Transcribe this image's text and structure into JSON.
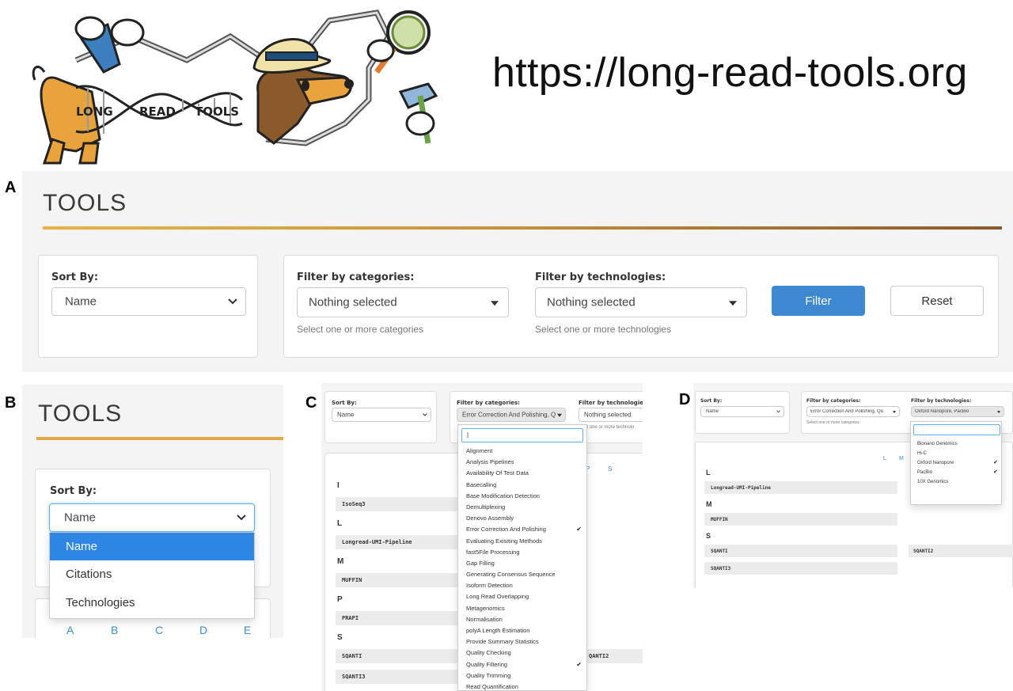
{
  "header": {
    "logo_text": "LONG READ TOOLS",
    "url": "https://long-read-tools.org"
  },
  "panel_labels": {
    "a": "A",
    "b": "B",
    "c": "C",
    "d": "D"
  },
  "panel_a": {
    "title": "TOOLS",
    "sort_label": "Sort By:",
    "sort_value": "Name",
    "categories_label": "Filter by categories:",
    "categories_value": "Nothing selected",
    "categories_hint": "Select one or more categories",
    "technologies_label": "Filter by technologies:",
    "technologies_value": "Nothing selected",
    "technologies_hint": "Select one or more technologies",
    "filter_button": "Filter",
    "reset_button": "Reset",
    "accent_color": "#3d88d1"
  },
  "panel_b": {
    "title": "TOOLS",
    "sort_label": "Sort By:",
    "sort_value": "Name",
    "options": [
      "Name",
      "Citations",
      "Technologies"
    ],
    "selected_option": "Name",
    "alphabet": [
      "A",
      "B",
      "C",
      "D",
      "E"
    ]
  },
  "panel_c": {
    "sort_label": "Sort By:",
    "sort_value": "Name",
    "categories_label": "Filter by categories:",
    "categories_value": "Error Correction And Polishing, Qu",
    "technologies_label": "Filter by technologies:",
    "technologies_value": "Nothing selected",
    "technologies_hint": "ect one or more technolo",
    "search_value": "|",
    "category_options": [
      {
        "label": "Alignment",
        "checked": false
      },
      {
        "label": "Analysis Pipelines",
        "checked": false
      },
      {
        "label": "Availability Of Test Data",
        "checked": false
      },
      {
        "label": "Basecalling",
        "checked": false
      },
      {
        "label": "Base Modification Detection",
        "checked": false
      },
      {
        "label": "Demultiplexing",
        "checked": false
      },
      {
        "label": "Denovo Assembly",
        "checked": false
      },
      {
        "label": "Error Correction And Polishing",
        "checked": true
      },
      {
        "label": "Evaluating Exisiting Methods",
        "checked": false
      },
      {
        "label": "fast5File Processing",
        "checked": false
      },
      {
        "label": "Gap Filling",
        "checked": false
      },
      {
        "label": "Generating Consensus Sequence",
        "checked": false
      },
      {
        "label": "Isoform Detection",
        "checked": false
      },
      {
        "label": "Long Read Overlapping",
        "checked": false
      },
      {
        "label": "Metagenomics",
        "checked": false
      },
      {
        "label": "Normalisation",
        "checked": false
      },
      {
        "label": "polyA Length Estimation",
        "checked": false
      },
      {
        "label": "Provide Summary Statistics",
        "checked": false
      },
      {
        "label": "Quality Checking",
        "checked": false
      },
      {
        "label": "Quality Filtering",
        "checked": true
      },
      {
        "label": "Quality Trimming",
        "checked": false
      },
      {
        "label": "Read Quantification",
        "checked": false
      }
    ],
    "alpha_visible": [
      "P",
      "S"
    ],
    "groups": [
      {
        "letter": "I",
        "tools": [
          "IsoSeq3"
        ]
      },
      {
        "letter": "L",
        "tools": [
          "Longread-UMI-Pipeline"
        ]
      },
      {
        "letter": "M",
        "tools": [
          "MUFFIN"
        ]
      },
      {
        "letter": "P",
        "tools": [
          "PRAPI"
        ]
      },
      {
        "letter": "S",
        "tools": [
          "SQANTI",
          "SQANTI3"
        ]
      }
    ],
    "partial_tool": "QANTI2",
    "check_mark": "✔"
  },
  "panel_d": {
    "sort_label": "Sort By:",
    "sort_value": "Name",
    "categories_label": "Filter by categories:",
    "categories_value": "Error Correction And Polishing, Qu",
    "categories_hint": "Select one or more categories",
    "technologies_label": "Filter by technologies:",
    "technologies_value": "Oxford Nanopore, PacBio",
    "tech_options": [
      {
        "label": "Bionano Genomics",
        "checked": false
      },
      {
        "label": "Hi-C",
        "checked": false
      },
      {
        "label": "Oxford Nanopore",
        "checked": true
      },
      {
        "label": "PacBio",
        "checked": true
      },
      {
        "label": "10X Genomics",
        "checked": false
      }
    ],
    "alpha_visible": [
      "L",
      "M"
    ],
    "groups": [
      {
        "letter": "L",
        "tools": [
          "Longread-UMI-Pipeline"
        ]
      },
      {
        "letter": "M",
        "tools": [
          "MUFFIN"
        ]
      },
      {
        "letter": "S",
        "tools": [
          "SQANTI",
          "SQANTI2",
          "SQANTI3"
        ]
      }
    ],
    "check_mark": "✔"
  }
}
